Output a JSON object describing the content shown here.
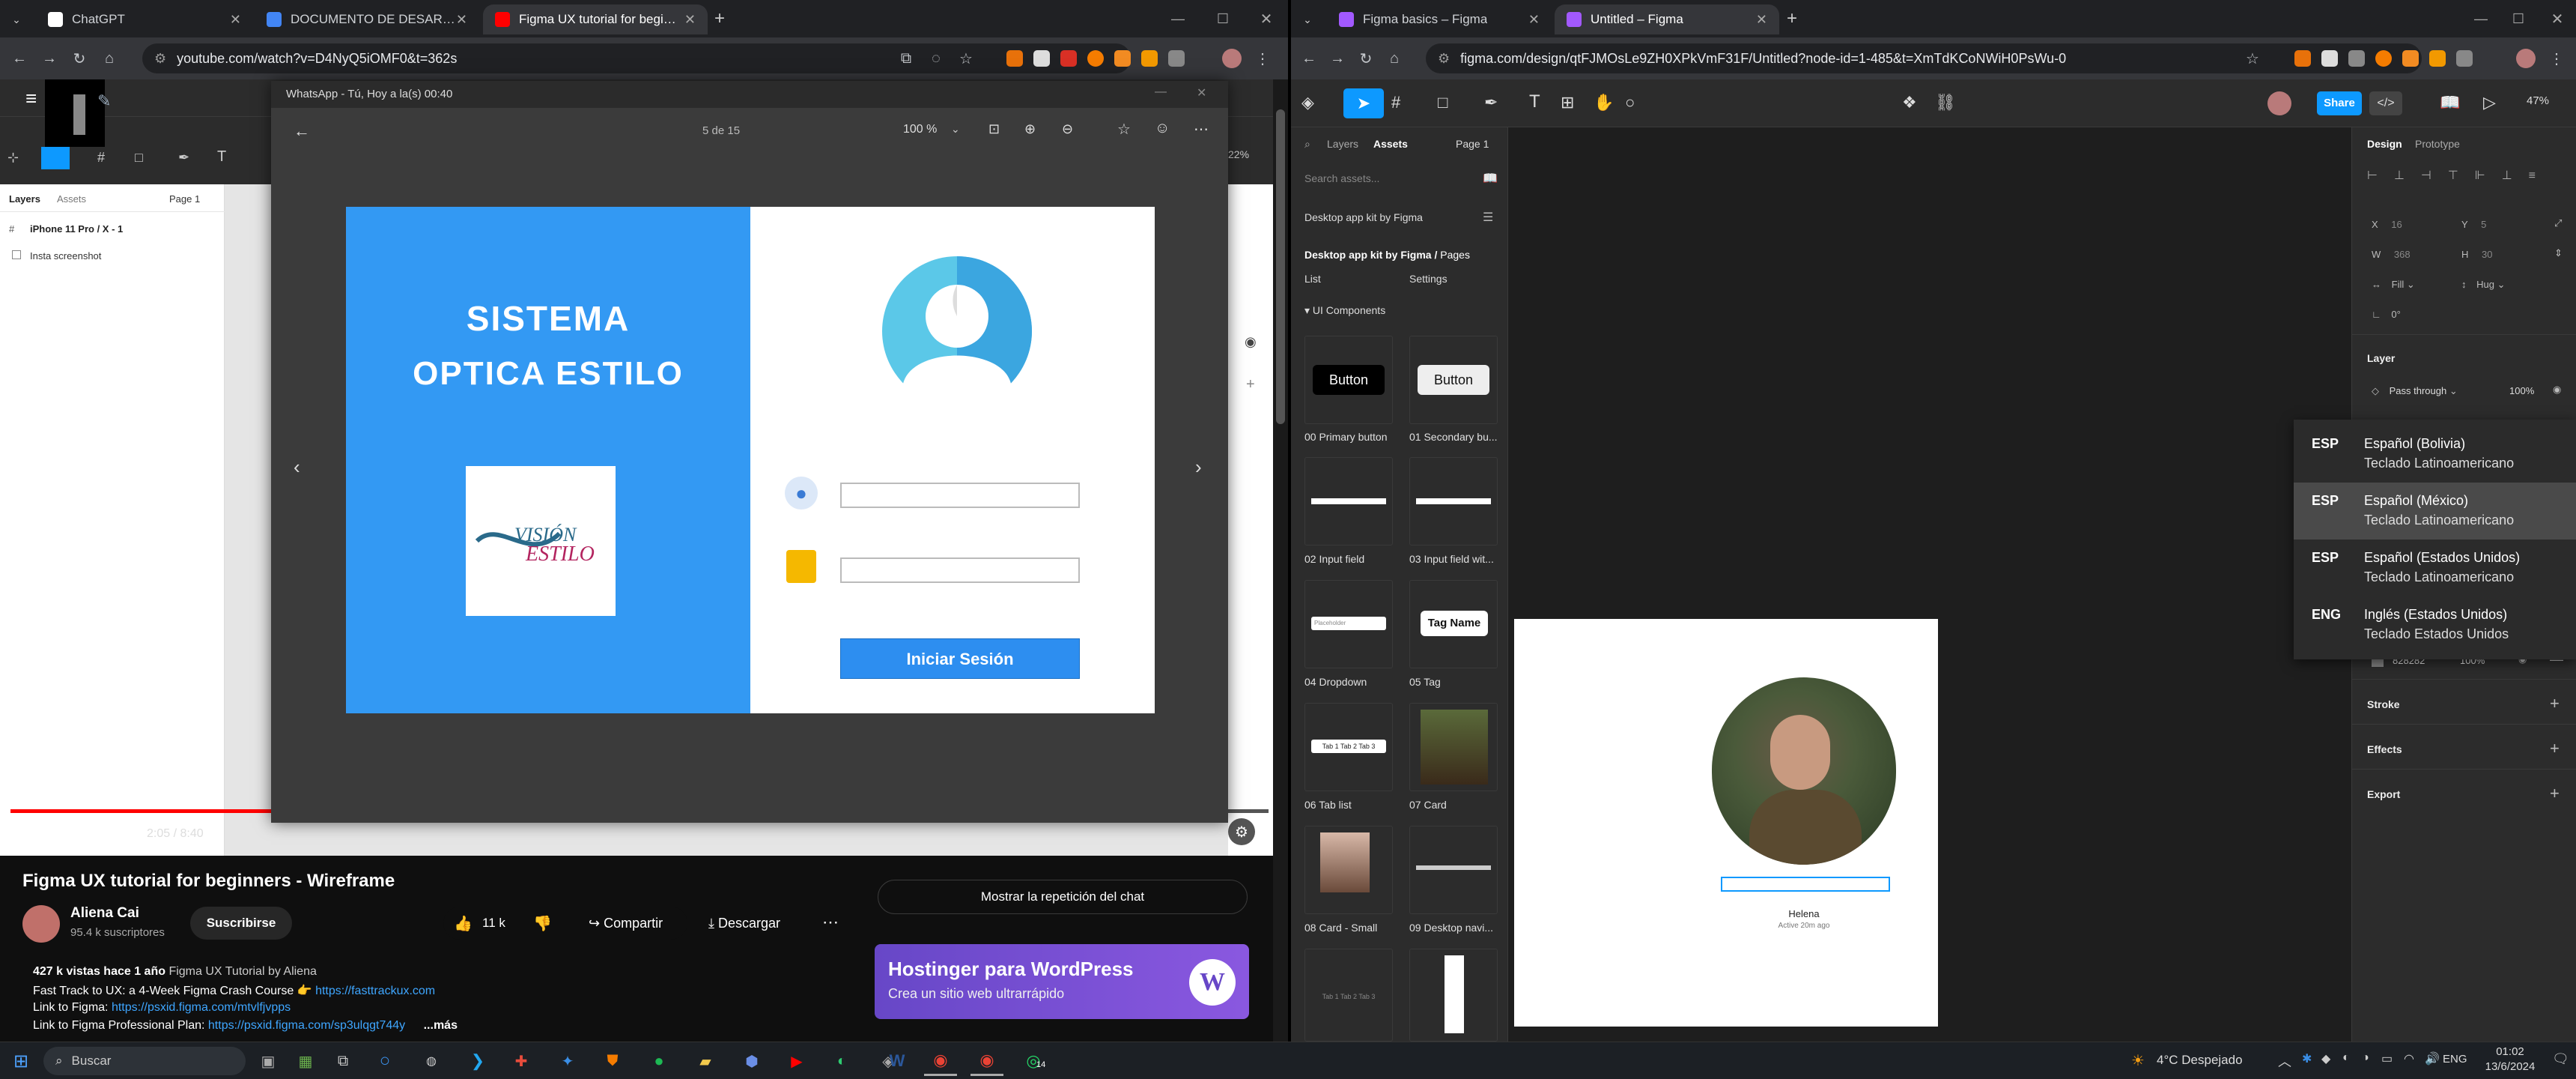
{
  "left_browser": {
    "tabs": [
      {
        "label": "ChatGPT"
      },
      {
        "label": "DOCUMENTO DE DESARROLLO"
      },
      {
        "label": "Figma UX tutorial for beginners"
      }
    ],
    "url": "youtube.com/watch?v=D4NyQ5iOMF0&t=362s"
  },
  "right_browser": {
    "tabs": [
      {
        "label": "Figma basics – Figma"
      },
      {
        "label": "Untitled – Figma"
      }
    ],
    "url": "figma.com/design/qtFJMOsLe9ZH0XPkVmF31F/Untitled?node-id=1-485&t=XmTdKCoNWiH0PsWu-0"
  },
  "whatsapp": {
    "title": "WhatsApp - Tú, Hoy a la(s) 00:40",
    "counter": "5 de 15",
    "zoom": "100 %",
    "slide": {
      "title_line1": "SISTEMA",
      "title_line2": "OPTICA ESTILO",
      "logo_text": "VISIÓN ESTILO",
      "login_button": "Iniciar Sesión"
    }
  },
  "yt_figma": {
    "tabs": [
      "Layers",
      "Assets"
    ],
    "page": "Page 1",
    "frame": "iPhone 11 Pro / X - 1",
    "layer": "Insta screenshot",
    "zoom": "22%"
  },
  "video": {
    "time": "2:05 / 8:40",
    "title": "Figma UX tutorial for beginners - Wireframe",
    "channel": "Aliena Cai",
    "subscribers": "95.4 k suscriptores",
    "subscribe": "Suscribirse",
    "likes": "11 k",
    "share": "Compartir",
    "download": "Descargar",
    "desc_stats": "427 k vistas  hace 1 año",
    "desc_tag": "Figma UX Tutorial by Aliena",
    "desc_line2": "Fast Track to UX: a 4-Week Figma Crash Course 👉",
    "desc_link2": "https://fasttrackux.com",
    "desc_line3": "Link to Figma:",
    "desc_link3": "https://psxid.figma.com/mtvlfjvpps",
    "desc_line4": "Link to Figma Professional Plan:",
    "desc_link4": "https://psxid.figma.com/sp3ulqgt744y",
    "more": "...más",
    "chat_replay": "Mostrar la repetición del chat",
    "ad_title": "Hostinger para WordPress",
    "ad_subtitle": "Crea un sitio web ultrarrápido"
  },
  "figma": {
    "zoom": "47%",
    "share": "Share",
    "tabs": [
      "Layers",
      "Assets"
    ],
    "page": "Page 1",
    "search_placeholder": "Search assets...",
    "library": "Desktop app kit by Figma",
    "breadcrumb_lib": "Desktop app kit by Figma /",
    "breadcrumb_pages": "Pages",
    "list": "List",
    "settings": "Settings",
    "section": "UI Components",
    "components": [
      {
        "label": "00 Primary button",
        "preview": "Button"
      },
      {
        "label": "01 Secondary bu...",
        "preview": "Button"
      },
      {
        "label": "02 Input field",
        "preview": ""
      },
      {
        "label": "03 Input field wit...",
        "preview": ""
      },
      {
        "label": "04 Dropdown",
        "preview": "Placeholder"
      },
      {
        "label": "05 Tag",
        "preview": "Tag Name"
      },
      {
        "label": "06 Tab list",
        "preview": "Tab 1  Tab 2  Tab 3"
      },
      {
        "label": "07 Card",
        "preview": ""
      },
      {
        "label": "08 Card - Small",
        "preview": ""
      },
      {
        "label": "09 Desktop navi...",
        "preview": ""
      },
      {
        "label": "",
        "preview": "Tab 1  Tab 2  Tab 3"
      },
      {
        "label": "",
        "preview": ""
      }
    ],
    "canvas_name": "Helena",
    "canvas_status": "Active 20m ago",
    "right_tabs": [
      "Design",
      "Prototype"
    ],
    "x": "16",
    "y": "5",
    "w": "368",
    "h": "30",
    "fill": "Fill",
    "hug": "Hug",
    "rotation": "0°",
    "layer_title": "Layer",
    "blend": "Pass through",
    "opacity": "100%",
    "fill_hex": "828282",
    "fill_opacity": "100%",
    "stroke": "Stroke",
    "effects": "Effects",
    "export": "Export"
  },
  "lang_popup": [
    {
      "code": "ESP",
      "line1": "Español (Bolivia)",
      "line2": "Teclado Latinoamericano"
    },
    {
      "code": "ESP",
      "line1": "Español (México)",
      "line2": "Teclado Latinoamericano"
    },
    {
      "code": "ESP",
      "line1": "Español (Estados Unidos)",
      "line2": "Teclado Latinoamericano"
    },
    {
      "code": "ENG",
      "line1": "Inglés (Estados Unidos)",
      "line2": "Teclado Estados Unidos"
    }
  ],
  "taskbar": {
    "search": "Buscar",
    "weather": "4°C  Despejado",
    "lang": "ENG",
    "time": "01:02",
    "date": "13/6/2024",
    "whatsapp_badge": "14"
  }
}
